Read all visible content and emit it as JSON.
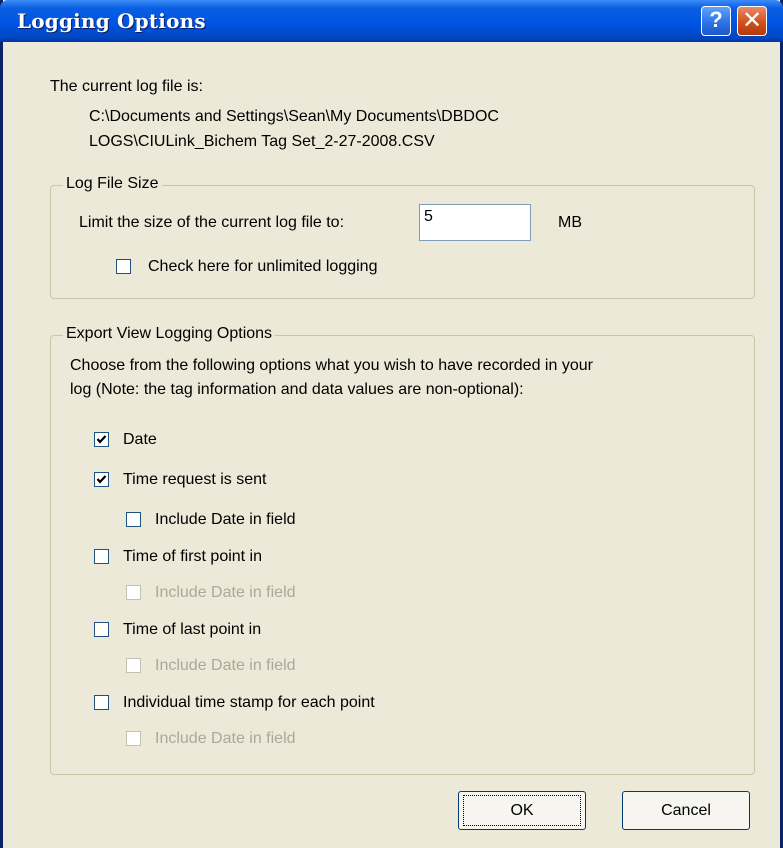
{
  "window": {
    "title": "Logging Options"
  },
  "titlebar": {
    "help_glyph": "?",
    "close_glyph": "✕"
  },
  "current_log": {
    "label": "The current log file is:",
    "path_line1": "C:\\Documents and Settings\\Sean\\My Documents\\DBDOC",
    "path_line2": "LOGS\\CIULink_Bichem Tag Set_2-27-2008.CSV"
  },
  "log_file_size": {
    "legend": "Log File Size",
    "limit_label": "Limit the size of the current log file to:",
    "limit_value": "5",
    "unit": "MB",
    "unlimited_label": "Check here for unlimited logging",
    "unlimited_checked": false
  },
  "export_view": {
    "legend": "Export View Logging Options",
    "description_line1": "Choose from the following options what you wish to have recorded in your",
    "description_line2": "log  (Note: the tag information and data values are non-optional):",
    "options": [
      {
        "label": "Date",
        "checked": true,
        "enabled": true
      },
      {
        "label": "Time request is sent",
        "checked": true,
        "enabled": true
      },
      {
        "label": "Include Date in field",
        "checked": false,
        "enabled": true
      },
      {
        "label": "Time of first point in",
        "checked": false,
        "enabled": true
      },
      {
        "label": "Include Date in field",
        "checked": false,
        "enabled": false
      },
      {
        "label": "Time of last point in",
        "checked": false,
        "enabled": true
      },
      {
        "label": "Include Date in field",
        "checked": false,
        "enabled": false
      },
      {
        "label": "Individual time stamp for each point",
        "checked": false,
        "enabled": true
      },
      {
        "label": "Include Date in field",
        "checked": false,
        "enabled": false
      }
    ]
  },
  "buttons": {
    "ok": "OK",
    "cancel": "Cancel"
  },
  "colors": {
    "titlebar": "#0054e3",
    "dialog_bg": "#ece9d8",
    "close_button": "#d2501c",
    "disabled_text": "#aca899"
  }
}
